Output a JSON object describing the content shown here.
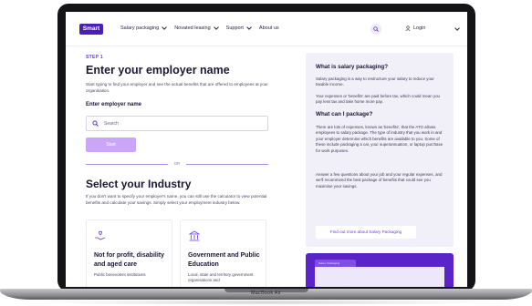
{
  "device": {
    "label": "MacBook Air"
  },
  "nav": {
    "logo": "Smart",
    "links": [
      "Salary packaging",
      "Novated leasing",
      "Support",
      "About us"
    ],
    "login": "Login"
  },
  "left": {
    "step": "STEP 1",
    "title": "Enter your employer name",
    "intro": "Start typing to find your employer and see the actual benefits that are offered to employees at your organisation.",
    "field_label": "Enter employer name",
    "search_placeholder": "Search",
    "start_button": "Start",
    "or": "OR",
    "industry_title": "Select your Industry",
    "industry_desc": "If you don't want to specify your employer's name, you can still use the calculator to view potential benefits and calculate your savings. Simply select your employment industry below.",
    "cards": [
      {
        "title": "Not for profit, disability and aged care",
        "text": "Public benevolent institutions"
      },
      {
        "title": "Government and Public Education",
        "text": "Local, state and territory government organisations and"
      }
    ]
  },
  "panel": {
    "q1": "What is salary packaging?",
    "p1": "Salary packaging is a way to restructure your salary to reduce your taxable income.",
    "p2": "Your expenses or 'benefits' are paid before tax, which could mean you pay less tax and take home more pay.",
    "q2": "What can I package?",
    "p3": "There are lots of expenses, known as 'benefits', that the ATO allows employees to salary package. The type of industry that you work in and your employer determine which benefits are available to you. Some of these include packaging a car, your superannuation, or laptop purchase for work purposes.",
    "p4": "Answer a few questions about your job and your regular expenses, and we'll recommend the best package of benefits that could see you maximise your savings.",
    "button": "Find out more about Salary Packaging",
    "folder_label": "Salary Packaging"
  },
  "colors": {
    "brand": "#4a1fb8",
    "accent": "#6a3de8",
    "button": "#c9a6f7",
    "panel": "#f1eff8"
  }
}
